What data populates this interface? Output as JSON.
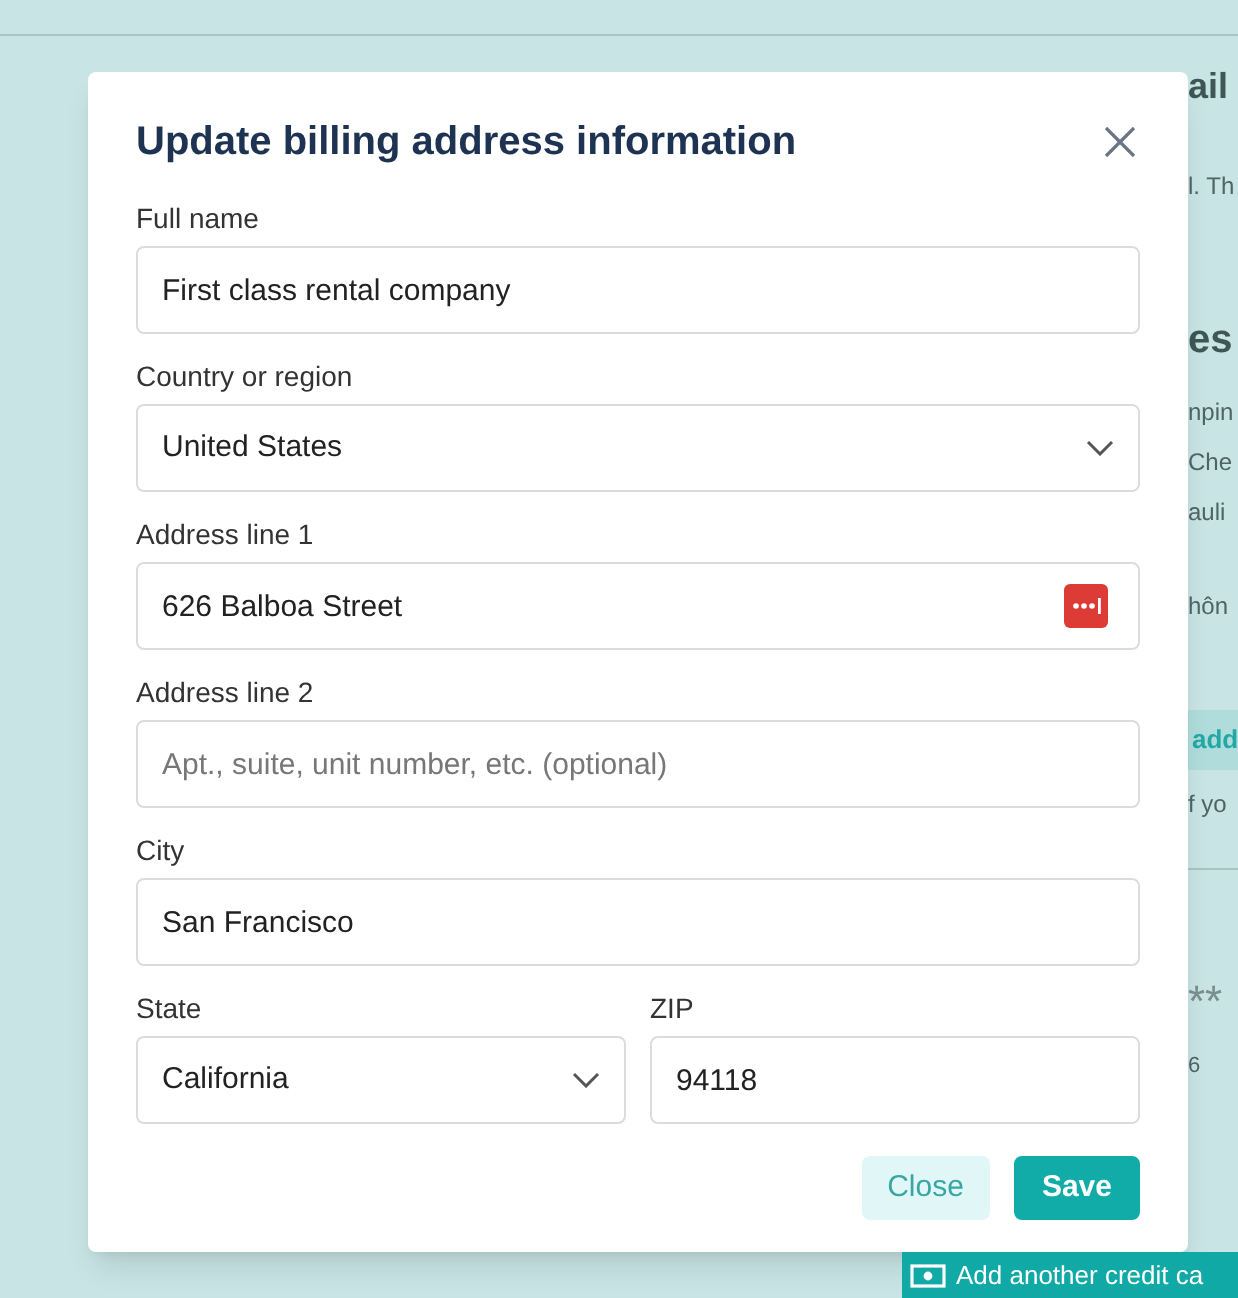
{
  "background": {
    "fragments": [
      {
        "kind": "title",
        "text": "ail"
      },
      {
        "kind": "text",
        "text": "l. Th"
      },
      {
        "kind": "heading",
        "text": "es"
      },
      {
        "kind": "text",
        "text": "npin"
      },
      {
        "kind": "text",
        "text": "Che"
      },
      {
        "kind": "text",
        "text": "auli"
      },
      {
        "kind": "text",
        "text": "hôn"
      },
      {
        "kind": "link",
        "text": "add"
      },
      {
        "kind": "text",
        "text": "f yo"
      },
      {
        "kind": "masked",
        "text": "**"
      },
      {
        "kind": "small",
        "text": "6"
      }
    ],
    "add_card_button": "Add another credit ca"
  },
  "dialog": {
    "title": "Update billing address information",
    "fields": [
      {
        "kind": "text",
        "label": "Full name",
        "value": "First class rental company"
      },
      {
        "kind": "select",
        "label": "Country or region",
        "value": "United States"
      },
      {
        "kind": "text",
        "label": "Address line 1",
        "value": "626 Balboa Street",
        "password_manager": true
      },
      {
        "kind": "text",
        "label": "Address line 2",
        "placeholder": "Apt., suite, unit number, etc. (optional)"
      },
      {
        "kind": "text",
        "label": "City",
        "value": "San Francisco"
      }
    ],
    "row": [
      {
        "kind": "select",
        "label": "State",
        "value": "California"
      },
      {
        "kind": "text",
        "label": "ZIP",
        "value": "94118"
      }
    ],
    "buttons": [
      {
        "kind": "secondary",
        "label": "Close"
      },
      {
        "kind": "primary",
        "label": "Save"
      }
    ]
  }
}
